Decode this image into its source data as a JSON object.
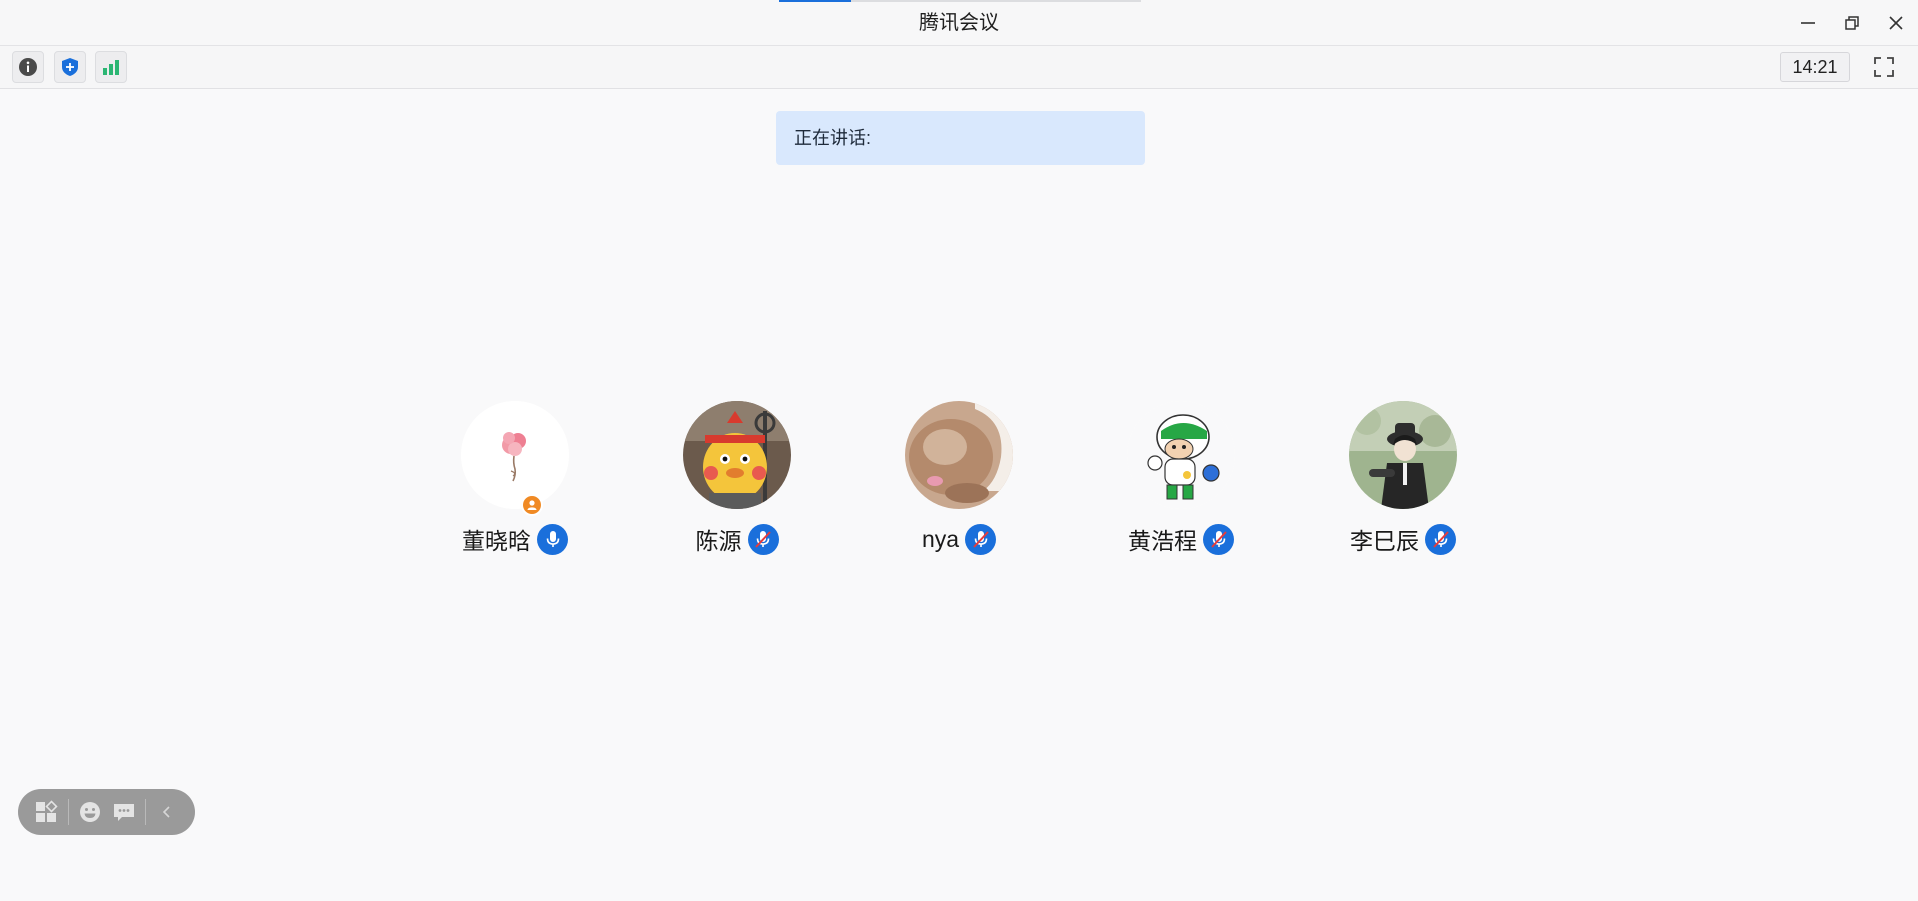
{
  "window": {
    "title": "腾讯会议"
  },
  "toolbar": {
    "icons": [
      "info-icon",
      "shield-icon",
      "signal-icon",
      "fullscreen-icon"
    ],
    "clock": "14:21"
  },
  "banner": {
    "speaking_label": "正在讲话:"
  },
  "participants": [
    {
      "name": "董晓晗",
      "mic": "on",
      "is_host": true
    },
    {
      "name": "陈源",
      "mic": "muted",
      "is_host": false
    },
    {
      "name": "nya",
      "mic": "muted",
      "is_host": false
    },
    {
      "name": "黄浩程",
      "mic": "muted",
      "is_host": false
    },
    {
      "name": "李巳辰",
      "mic": "muted",
      "is_host": false
    }
  ],
  "floating_toolbar": {
    "icons": [
      "layout-icon",
      "emoji-icon",
      "chat-icon",
      "collapse-icon"
    ]
  },
  "colors": {
    "accent": "#1a6fdb",
    "banner_bg": "#d9e8fd",
    "host_badge": "#f08a24",
    "signal": "#2bb673"
  }
}
